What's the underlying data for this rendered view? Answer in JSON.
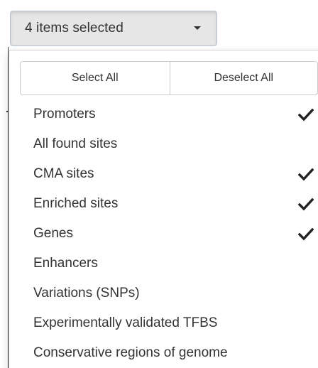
{
  "dropdown": {
    "button_label": "4 items selected",
    "caret_icon": "caret-down-icon"
  },
  "actions": {
    "select_all": "Select All",
    "deselect_all": "Deselect All"
  },
  "options": [
    {
      "label": "Promoters",
      "selected": true
    },
    {
      "label": "All found sites",
      "selected": false
    },
    {
      "label": "CMA sites",
      "selected": true
    },
    {
      "label": "Enriched sites",
      "selected": true
    },
    {
      "label": "Genes",
      "selected": true
    },
    {
      "label": "Enhancers",
      "selected": false
    },
    {
      "label": "Variations (SNPs)",
      "selected": false
    },
    {
      "label": "Experimentally validated TFBS",
      "selected": false
    },
    {
      "label": "Conservative regions of genome",
      "selected": false
    }
  ],
  "colors": {
    "text": "#333333",
    "button_bg": "#e6e6e6",
    "border": "#cccccc",
    "check": "#222222"
  }
}
